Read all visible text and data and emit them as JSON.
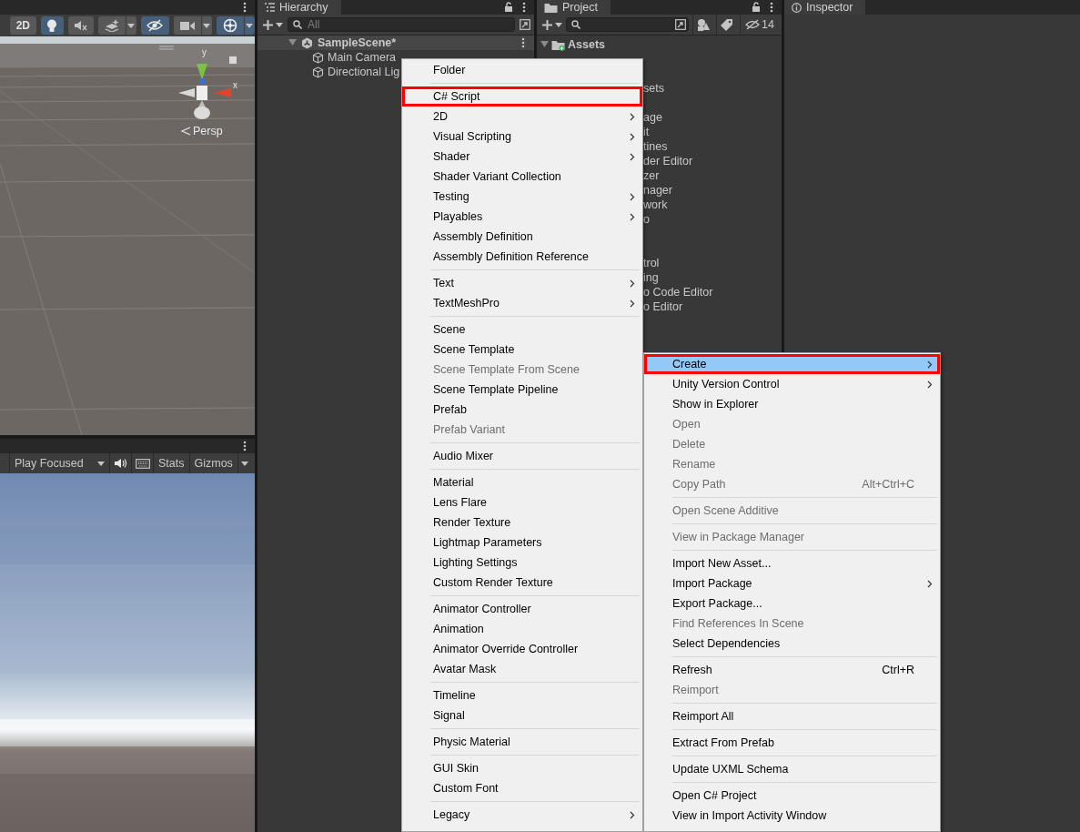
{
  "scene_view": {
    "toolbar": [
      {
        "kind": "text",
        "label": "2D",
        "on": false,
        "dropdown": false
      },
      {
        "kind": "lighting",
        "on": true,
        "dropdown": false
      },
      {
        "kind": "audio",
        "on": false,
        "dropdown": false
      },
      {
        "kind": "effects",
        "on": false,
        "dropdown": true
      },
      {
        "kind": "visibility",
        "on": true,
        "dropdown": false
      },
      {
        "kind": "camera",
        "on": false,
        "dropdown": true
      },
      {
        "kind": "gizmos",
        "on": true,
        "dropdown": true
      }
    ],
    "axis_labels": [
      "y",
      "x"
    ],
    "projection": "Persp"
  },
  "game_view": {
    "toolbar": [
      {
        "kind": "dropdown",
        "label": "Play Focused"
      },
      {
        "kind": "audio"
      },
      {
        "kind": "keyboard"
      },
      {
        "kind": "text",
        "label": "Stats"
      },
      {
        "kind": "split",
        "label": "Gizmos"
      }
    ]
  },
  "hierarchy": {
    "tab": "Hierarchy",
    "search_placeholder": "All",
    "scene": {
      "name": "SampleScene*",
      "expanded": true,
      "children": [
        {
          "name": "Main Camera"
        },
        {
          "name": "Directional Lig"
        }
      ]
    }
  },
  "project": {
    "tab": "Project",
    "hidden_count": "14",
    "root": {
      "name": "Assets",
      "expanded": true
    },
    "visible_fragments": [
      [
        "sets"
      ],
      [
        "age",
        "it",
        "tines",
        "der Editor",
        "zer",
        "nager",
        "work",
        "o"
      ],
      [
        "trol",
        "ing",
        "o Code Editor",
        "o Editor"
      ]
    ]
  },
  "inspector": {
    "tab": "Inspector"
  },
  "context_menu": {
    "sections": [
      [
        {
          "label": "Create",
          "submenu": true,
          "disabled": false,
          "selected": true,
          "annotated": true
        },
        {
          "label": "Unity Version Control",
          "submenu": true,
          "disabled": false,
          "selected": false,
          "annotated": false
        },
        {
          "label": "Show in Explorer",
          "submenu": false,
          "disabled": false,
          "selected": false,
          "annotated": false
        },
        {
          "label": "Open",
          "submenu": false,
          "disabled": true,
          "selected": false,
          "annotated": false
        },
        {
          "label": "Delete",
          "submenu": false,
          "disabled": true,
          "selected": false,
          "annotated": false
        },
        {
          "label": "Rename",
          "submenu": false,
          "disabled": true,
          "selected": false,
          "annotated": false
        },
        {
          "label": "Copy Path",
          "shortcut": "Alt+Ctrl+C",
          "submenu": false,
          "disabled": true,
          "selected": false,
          "annotated": false
        }
      ],
      [
        {
          "label": "Open Scene Additive",
          "submenu": false,
          "disabled": true,
          "selected": false,
          "annotated": false
        }
      ],
      [
        {
          "label": "View in Package Manager",
          "submenu": false,
          "disabled": true,
          "selected": false,
          "annotated": false
        }
      ],
      [
        {
          "label": "Import New Asset...",
          "submenu": false,
          "disabled": false,
          "selected": false,
          "annotated": false
        },
        {
          "label": "Import Package",
          "submenu": true,
          "disabled": false,
          "selected": false,
          "annotated": false
        },
        {
          "label": "Export Package...",
          "submenu": false,
          "disabled": false,
          "selected": false,
          "annotated": false
        },
        {
          "label": "Find References In Scene",
          "submenu": false,
          "disabled": true,
          "selected": false,
          "annotated": false
        },
        {
          "label": "Select Dependencies",
          "submenu": false,
          "disabled": false,
          "selected": false,
          "annotated": false
        }
      ],
      [
        {
          "label": "Refresh",
          "shortcut": "Ctrl+R",
          "submenu": false,
          "disabled": false,
          "selected": false,
          "annotated": false
        },
        {
          "label": "Reimport",
          "submenu": false,
          "disabled": true,
          "selected": false,
          "annotated": false
        }
      ],
      [
        {
          "label": "Reimport All",
          "submenu": false,
          "disabled": false,
          "selected": false,
          "annotated": false
        }
      ],
      [
        {
          "label": "Extract From Prefab",
          "submenu": false,
          "disabled": false,
          "selected": false,
          "annotated": false
        }
      ],
      [
        {
          "label": "Update UXML Schema",
          "submenu": false,
          "disabled": false,
          "selected": false,
          "annotated": false
        }
      ],
      [
        {
          "label": "Open C# Project",
          "submenu": false,
          "disabled": false,
          "selected": false,
          "annotated": false
        },
        {
          "label": "View in Import Activity Window",
          "submenu": false,
          "disabled": false,
          "selected": false,
          "annotated": false
        }
      ]
    ]
  },
  "create_submenu": {
    "sections": [
      [
        {
          "label": "Folder",
          "submenu": false,
          "disabled": false,
          "selected": false,
          "annotated": false
        }
      ],
      [
        {
          "label": "C# Script",
          "submenu": false,
          "disabled": false,
          "selected": false,
          "annotated": true
        },
        {
          "label": "2D",
          "submenu": true,
          "disabled": false,
          "selected": false,
          "annotated": false
        },
        {
          "label": "Visual Scripting",
          "submenu": true,
          "disabled": false,
          "selected": false,
          "annotated": false
        },
        {
          "label": "Shader",
          "submenu": true,
          "disabled": false,
          "selected": false,
          "annotated": false
        },
        {
          "label": "Shader Variant Collection",
          "submenu": false,
          "disabled": false,
          "selected": false,
          "annotated": false
        },
        {
          "label": "Testing",
          "submenu": true,
          "disabled": false,
          "selected": false,
          "annotated": false
        },
        {
          "label": "Playables",
          "submenu": true,
          "disabled": false,
          "selected": false,
          "annotated": false
        },
        {
          "label": "Assembly Definition",
          "submenu": false,
          "disabled": false,
          "selected": false,
          "annotated": false
        },
        {
          "label": "Assembly Definition Reference",
          "submenu": false,
          "disabled": false,
          "selected": false,
          "annotated": false
        }
      ],
      [
        {
          "label": "Text",
          "submenu": true,
          "disabled": false,
          "selected": false,
          "annotated": false
        },
        {
          "label": "TextMeshPro",
          "submenu": true,
          "disabled": false,
          "selected": false,
          "annotated": false
        }
      ],
      [
        {
          "label": "Scene",
          "submenu": false,
          "disabled": false,
          "selected": false,
          "annotated": false
        },
        {
          "label": "Scene Template",
          "submenu": false,
          "disabled": false,
          "selected": false,
          "annotated": false
        },
        {
          "label": "Scene Template From Scene",
          "submenu": false,
          "disabled": true,
          "selected": false,
          "annotated": false
        },
        {
          "label": "Scene Template Pipeline",
          "submenu": false,
          "disabled": false,
          "selected": false,
          "annotated": false
        },
        {
          "label": "Prefab",
          "submenu": false,
          "disabled": false,
          "selected": false,
          "annotated": false
        },
        {
          "label": "Prefab Variant",
          "submenu": false,
          "disabled": true,
          "selected": false,
          "annotated": false
        }
      ],
      [
        {
          "label": "Audio Mixer",
          "submenu": false,
          "disabled": false,
          "selected": false,
          "annotated": false
        }
      ],
      [
        {
          "label": "Material",
          "submenu": false,
          "disabled": false,
          "selected": false,
          "annotated": false
        },
        {
          "label": "Lens Flare",
          "submenu": false,
          "disabled": false,
          "selected": false,
          "annotated": false
        },
        {
          "label": "Render Texture",
          "submenu": false,
          "disabled": false,
          "selected": false,
          "annotated": false
        },
        {
          "label": "Lightmap Parameters",
          "submenu": false,
          "disabled": false,
          "selected": false,
          "annotated": false
        },
        {
          "label": "Lighting Settings",
          "submenu": false,
          "disabled": false,
          "selected": false,
          "annotated": false
        },
        {
          "label": "Custom Render Texture",
          "submenu": false,
          "disabled": false,
          "selected": false,
          "annotated": false
        }
      ],
      [
        {
          "label": "Animator Controller",
          "submenu": false,
          "disabled": false,
          "selected": false,
          "annotated": false
        },
        {
          "label": "Animation",
          "submenu": false,
          "disabled": false,
          "selected": false,
          "annotated": false
        },
        {
          "label": "Animator Override Controller",
          "submenu": false,
          "disabled": false,
          "selected": false,
          "annotated": false
        },
        {
          "label": "Avatar Mask",
          "submenu": false,
          "disabled": false,
          "selected": false,
          "annotated": false
        }
      ],
      [
        {
          "label": "Timeline",
          "submenu": false,
          "disabled": false,
          "selected": false,
          "annotated": false
        },
        {
          "label": "Signal",
          "submenu": false,
          "disabled": false,
          "selected": false,
          "annotated": false
        }
      ],
      [
        {
          "label": "Physic Material",
          "submenu": false,
          "disabled": false,
          "selected": false,
          "annotated": false
        }
      ],
      [
        {
          "label": "GUI Skin",
          "submenu": false,
          "disabled": false,
          "selected": false,
          "annotated": false
        },
        {
          "label": "Custom Font",
          "submenu": false,
          "disabled": false,
          "selected": false,
          "annotated": false
        }
      ],
      [
        {
          "label": "Legacy",
          "submenu": true,
          "disabled": false,
          "selected": false,
          "annotated": false
        }
      ]
    ]
  }
}
